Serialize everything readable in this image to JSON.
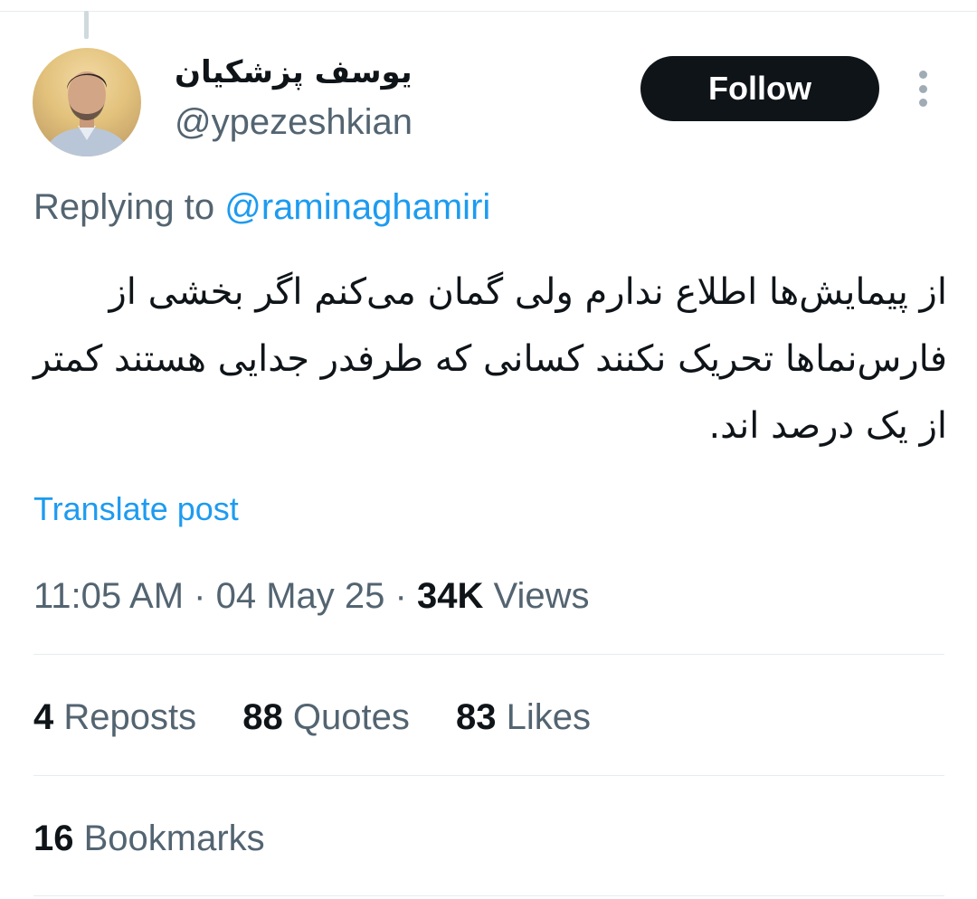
{
  "author": {
    "display_name": "یوسف پزشکیان",
    "handle": "@ypezeshkian"
  },
  "follow_label": "Follow",
  "reply": {
    "prefix": "Replying to",
    "mention": "@raminaghamiri"
  },
  "tweet_text": "از پیمایش‌ها اطلاع ندارم ولی گمان می‌کنم اگر بخشی از فارس‌نماها تحریک نکنند کسانی که طرفدر جدایی هستند کمتر از یک درصد اند.",
  "translate_label": "Translate post",
  "meta": {
    "time": "11:05 AM",
    "date": "04 May 25",
    "views_count": "34K",
    "views_label": "Views"
  },
  "stats": {
    "reposts_count": "4",
    "reposts_label": "Reposts",
    "quotes_count": "88",
    "quotes_label": "Quotes",
    "likes_count": "83",
    "likes_label": "Likes",
    "bookmarks_count": "16",
    "bookmarks_label": "Bookmarks"
  },
  "icons": {
    "more": "more-vertical-icon"
  },
  "colors": {
    "link": "#1d9bf0",
    "secondary_text": "#536471",
    "primary_text": "#0f1419",
    "follow_bg": "#0f1419"
  }
}
